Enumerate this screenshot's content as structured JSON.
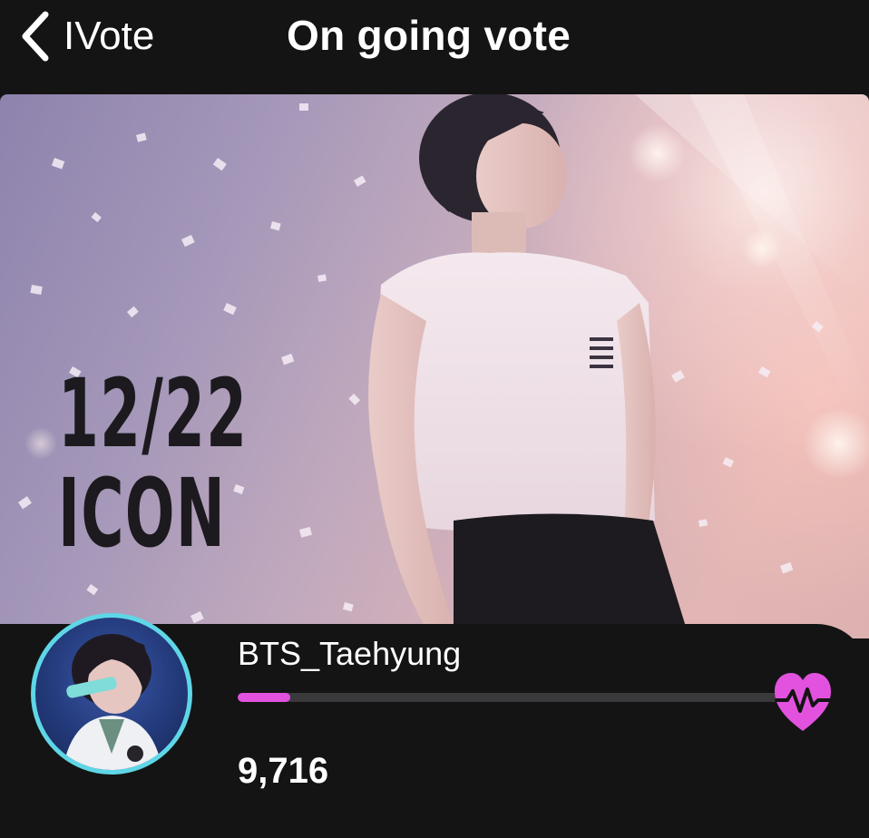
{
  "nav": {
    "back_label": "IVote",
    "title": "On going vote"
  },
  "banner": {
    "date": "12/22",
    "subtitle": "ICON"
  },
  "candidate": {
    "name": "BTS_Taehyung",
    "votes": "9,716",
    "progress_fraction": 0.095
  },
  "colors": {
    "accent": "#e252de",
    "avatar_ring": "#5fd6e6",
    "background": "#141414"
  },
  "icons": {
    "back": "chevron-left-icon",
    "vote": "heart-pulse-icon"
  }
}
